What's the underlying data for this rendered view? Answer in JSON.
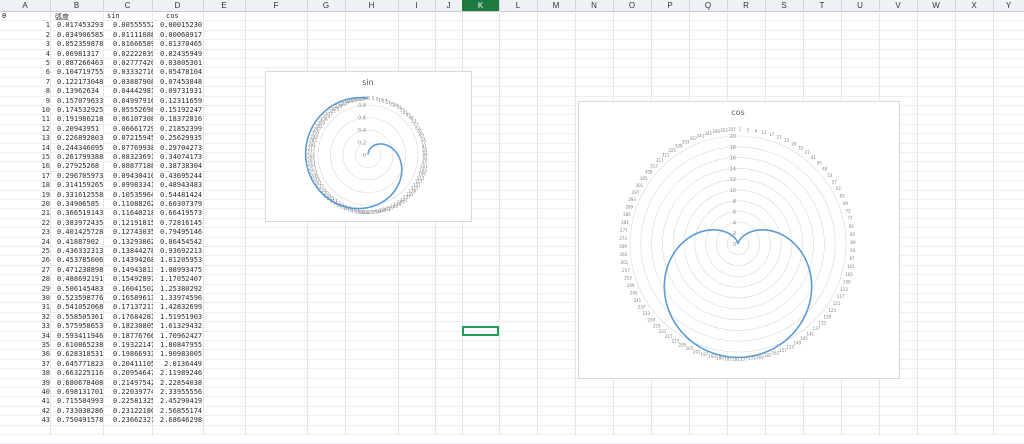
{
  "sheet": {
    "column_headers": [
      "A",
      "B",
      "C",
      "D",
      "E",
      "F",
      "G",
      "H",
      "I",
      "J",
      "K",
      "L",
      "M",
      "N",
      "O",
      "P",
      "Q",
      "R",
      "S",
      "T",
      "U",
      "V",
      "W",
      "X",
      "Y"
    ],
    "selected_column": "K",
    "a1_label": "θ",
    "b1_label": "弧度",
    "c1_label": "sin",
    "d1_label": "cos",
    "rows": [
      [
        "1",
        "0.017453293",
        "0.005555527",
        "0.000152304"
      ],
      [
        "2",
        "0.034906585",
        "0.011110882",
        "0.000609173"
      ],
      [
        "3",
        "0.052359878",
        "0.016665895",
        "0.013704652"
      ],
      [
        "4",
        "0.06981317",
        "0.022220393",
        "0.024359497"
      ],
      [
        "5",
        "0.087266463",
        "0.027774206",
        "0.038053019"
      ],
      [
        "6",
        "0.104719755",
        "0.033327161",
        "0.054781046"
      ],
      [
        "7",
        "0.122173048",
        "0.038879087",
        "0.074538484"
      ],
      [
        "8",
        "0.13962634",
        "0.044429814",
        "0.097319313"
      ],
      [
        "9",
        "0.157079633",
        "0.049979169",
        "0.123116594"
      ],
      [
        "10",
        "0.174532925",
        "0.055526982",
        "0.15192247"
      ],
      [
        "11",
        "0.191986218",
        "0.061073081",
        "0.183728166"
      ],
      [
        "12",
        "0.20943951",
        "0.066617295",
        "0.218523993"
      ],
      [
        "13",
        "0.226892803",
        "0.072159453",
        "0.256299352"
      ],
      [
        "14",
        "0.244346095",
        "0.077699384",
        "0.297042737"
      ],
      [
        "15",
        "0.261799388",
        "0.083236916",
        "0.340741737"
      ],
      [
        "16",
        "0.27925268",
        "0.08877188",
        "0.387383041"
      ],
      [
        "17",
        "0.296705973",
        "0.094304104",
        "0.43695244"
      ],
      [
        "18",
        "0.314159265",
        "0.099833417",
        "0.489434837"
      ],
      [
        "19",
        "0.331612558",
        "0.105359648",
        "0.544814244"
      ],
      [
        "20",
        "0.34906585",
        "0.110882629",
        "0.603073792"
      ],
      [
        "21",
        "0.366519143",
        "0.116402189",
        "0.664195735"
      ],
      [
        "22",
        "0.383972435",
        "0.121918151",
        "0.728161454"
      ],
      [
        "23",
        "0.401425728",
        "0.127430353",
        "0.794951465"
      ],
      [
        "24",
        "0.41887902",
        "0.132938623",
        "0.864545424"
      ],
      [
        "25",
        "0.436332313",
        "0.138442789",
        "0.93692213"
      ],
      [
        "26",
        "0.453785606",
        "0.143942682",
        "1.012059537"
      ],
      [
        "27",
        "0.471238898",
        "0.149438132",
        "1.089934758"
      ],
      [
        "28",
        "0.488692191",
        "0.154928971",
        "1.170524071"
      ],
      [
        "29",
        "0.506145483",
        "0.160415027",
        "1.253802929"
      ],
      [
        "30",
        "0.523598776",
        "0.165896133",
        "1.339745962"
      ],
      [
        "31",
        "0.541052068",
        "0.171372118",
        "1.428326993"
      ],
      [
        "32",
        "0.558505361",
        "0.176842814",
        "1.51951903"
      ],
      [
        "33",
        "0.575958653",
        "0.182308052",
        "1.613294321"
      ],
      [
        "34",
        "0.593411946",
        "0.187767663",
        "1.709624274"
      ],
      [
        "35",
        "0.610865238",
        "0.193221479",
        "1.808479557"
      ],
      [
        "36",
        "0.628318531",
        "0.198669331",
        "1.909830056"
      ],
      [
        "37",
        "0.645771823",
        "0.204111052",
        "2.0136449"
      ],
      [
        "38",
        "0.663225116",
        "0.209546472",
        "2.119892464"
      ],
      [
        "39",
        "0.680678408",
        "0.214975425",
        "2.228540385"
      ],
      [
        "40",
        "0.698131701",
        "0.220397743",
        "2.339555569"
      ],
      [
        "41",
        "0.715584993",
        "0.225813259",
        "2.452904198"
      ],
      [
        "42",
        "0.733038286",
        "0.231221806",
        "2.568551745"
      ],
      [
        "43",
        "0.750491578",
        "0.236623216",
        "2.686462984"
      ]
    ]
  },
  "charts": {
    "sin_title": "sin",
    "cos_title": "cos",
    "sin_rticks": [
      "0.8",
      "0.6",
      "0.4",
      "0.2",
      "0"
    ],
    "cos_rticks": [
      "20",
      "18",
      "16",
      "14",
      "12",
      "10",
      "8",
      "6",
      "4",
      "2",
      "0"
    ]
  },
  "chart_data": [
    {
      "type": "line",
      "title": "sin",
      "polar": true,
      "note_series": "r = sin(θ/180) for θ = 1..360 degrees",
      "x": [
        1,
        30,
        60,
        90,
        120,
        150,
        180,
        210,
        240,
        270,
        300,
        330,
        360
      ],
      "y": [
        0.005556,
        0.165896,
        0.327195,
        0.479426,
        0.61837,
        0.74073,
        0.841471,
        0.917918,
        0.96776,
        0.98871,
        0.979766,
        0.94147,
        0.873384
      ],
      "rlim": [
        0,
        0.8
      ],
      "color": "#5b9bd5"
    },
    {
      "type": "line",
      "title": "cos",
      "polar": true,
      "x": [
        1,
        45,
        90,
        135,
        180,
        225,
        270,
        315,
        360
      ],
      "y": [
        0.000152,
        0.0,
        0.0,
        0.0,
        0.0,
        0.0,
        0.0,
        0.0,
        0.0
      ],
      "rlim": [
        0,
        20
      ],
      "color": "#5b9bd5"
    }
  ]
}
